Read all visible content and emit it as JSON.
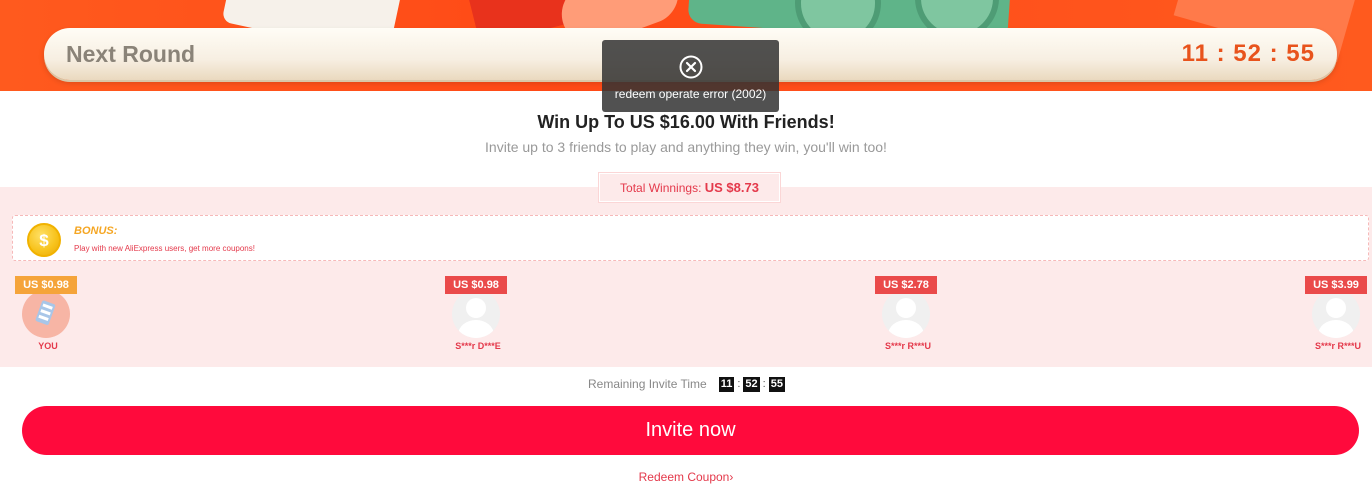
{
  "header": {
    "title": "Next Round",
    "timer": "11 : 52 : 55"
  },
  "toast": {
    "message": "redeem operate error (2002)",
    "icon": "close-circle-icon"
  },
  "promo": {
    "headline": "Win Up To US $16.00 With Friends!",
    "subline": "Invite up to 3 friends to play and anything they win, you'll win too!"
  },
  "total": {
    "label": "Total Winnings:",
    "value": "US $8.73"
  },
  "bonus": {
    "icon": "dollar-coin-icon",
    "coin_symbol": "$",
    "title": "BONUS:",
    "description": "Play with new AliExpress users, get more coupons!"
  },
  "friends": [
    {
      "amount": "US $0.98",
      "name": "YOU",
      "ribbon_color": "#f5a43a"
    },
    {
      "amount": "US $0.98",
      "name": "S***r D***E",
      "ribbon_color": "#ea4a4a"
    },
    {
      "amount": "US $2.78",
      "name": "S***r R***U",
      "ribbon_color": "#ea4a4a"
    },
    {
      "amount": "US $3.99",
      "name": "S***r R***U",
      "ribbon_color": "#ea4a4a"
    }
  ],
  "remaining": {
    "label": "Remaining Invite Time",
    "hours": "11",
    "minutes": "52",
    "seconds": "55",
    "separator": ":"
  },
  "actions": {
    "invite_label": "Invite now",
    "redeem_label": "Redeem Coupon",
    "redeem_chevron": "›"
  },
  "colors": {
    "accent": "#ff0a3c",
    "banner": "#ff5a1e",
    "timer": "#e8531c",
    "pink_bg": "#fdeaea",
    "label_red": "#e4394b",
    "bonus_gold": "#f5a623"
  }
}
